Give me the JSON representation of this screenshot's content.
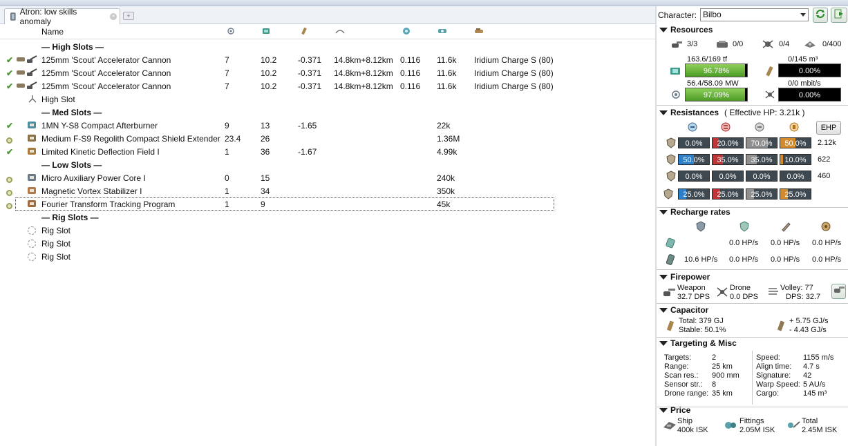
{
  "tab": {
    "title": "Atron: low skills anomaly"
  },
  "columns": {
    "name": "Name"
  },
  "rows": [
    {
      "kind": "section",
      "label": "— High Slots —"
    },
    {
      "kind": "module",
      "state": "active",
      "name": "125mm 'Scout' Accelerator Cannon",
      "cpu": "7",
      "pg": "10.2",
      "cap": "-0.371",
      "range": "14.8km+8.12km",
      "tracking": "0.116",
      "price": "11.6k",
      "charge": "Iridium Charge S (80)"
    },
    {
      "kind": "module",
      "state": "active",
      "name": "125mm 'Scout' Accelerator Cannon",
      "cpu": "7",
      "pg": "10.2",
      "cap": "-0.371",
      "range": "14.8km+8.12km",
      "tracking": "0.116",
      "price": "11.6k",
      "charge": "Iridium Charge S (80)"
    },
    {
      "kind": "module",
      "state": "active",
      "name": "125mm 'Scout' Accelerator Cannon",
      "cpu": "7",
      "pg": "10.2",
      "cap": "-0.371",
      "range": "14.8km+8.12km",
      "tracking": "0.116",
      "price": "11.6k",
      "charge": "Iridium Charge S (80)"
    },
    {
      "kind": "empty",
      "name": "High Slot"
    },
    {
      "kind": "section",
      "label": "— Med Slots —"
    },
    {
      "kind": "module",
      "state": "active",
      "name": "1MN Y-S8 Compact Afterburner",
      "cpu": "9",
      "pg": "13",
      "cap": "-1.65",
      "range": "",
      "tracking": "",
      "price": "22k",
      "charge": ""
    },
    {
      "kind": "module",
      "state": "online",
      "name": "Medium F-S9 Regolith Compact Shield Extender",
      "cpu": "23.4",
      "pg": "26",
      "cap": "",
      "range": "",
      "tracking": "",
      "price": "1.36M",
      "charge": ""
    },
    {
      "kind": "module",
      "state": "active",
      "name": "Limited Kinetic Deflection Field I",
      "cpu": "1",
      "pg": "36",
      "cap": "-1.67",
      "range": "",
      "tracking": "",
      "price": "4.99k",
      "charge": ""
    },
    {
      "kind": "section",
      "label": "— Low Slots —"
    },
    {
      "kind": "module",
      "state": "online",
      "name": "Micro Auxiliary Power Core I",
      "cpu": "0",
      "pg": "15",
      "cap": "",
      "range": "",
      "tracking": "",
      "price": "240k",
      "charge": ""
    },
    {
      "kind": "module",
      "state": "online",
      "name": "Magnetic Vortex Stabilizer I",
      "cpu": "1",
      "pg": "34",
      "cap": "",
      "range": "",
      "tracking": "",
      "price": "350k",
      "charge": ""
    },
    {
      "kind": "module",
      "state": "online",
      "name": "Fourier Transform Tracking Program",
      "cpu": "1",
      "pg": "9",
      "cap": "",
      "range": "",
      "tracking": "",
      "price": "45k",
      "charge": "",
      "selected": true
    },
    {
      "kind": "section",
      "label": "— Rig Slots —"
    },
    {
      "kind": "rig",
      "name": "Rig Slot"
    },
    {
      "kind": "rig",
      "name": "Rig Slot"
    },
    {
      "kind": "rig",
      "name": "Rig Slot"
    }
  ],
  "character": {
    "label": "Character:",
    "value": "Bilbo"
  },
  "resources": {
    "title": "Resources",
    "turrets": "3/3",
    "launchers": "0/0",
    "drone_bay": "0/4",
    "drone_bw_count": "0/400",
    "cpu_label": "163.6/169 tf",
    "cpu_pct": "96.78%",
    "cpu_frac": 0.9678,
    "cargo_label": "0/145 m³",
    "cargo_pct": "0.00%",
    "cargo_frac": 0,
    "pg_label": "56.4/58.09 MW",
    "pg_pct": "97.09%",
    "pg_frac": 0.9709,
    "bw_label": "0/0 mbit/s",
    "bw_pct": "0.00%",
    "bw_frac": 0
  },
  "resistances": {
    "title": "Resistances",
    "ehp_note": "( Effective HP: 3.21k )",
    "ehp_button": "EHP",
    "layers": [
      {
        "name": "shield",
        "values": [
          "0.0%",
          "20.0%",
          "70.0%",
          "50.0%"
        ],
        "fracs": [
          0,
          0.2,
          0.7,
          0.5
        ],
        "hp": "2.12k"
      },
      {
        "name": "armor",
        "values": [
          "50.0%",
          "35.0%",
          "35.0%",
          "10.0%"
        ],
        "fracs": [
          0.5,
          0.35,
          0.35,
          0.1
        ],
        "hp": "622"
      },
      {
        "name": "hull",
        "values": [
          "0.0%",
          "0.0%",
          "0.0%",
          "0.0%"
        ],
        "fracs": [
          0,
          0,
          0,
          0
        ],
        "hp": "460"
      },
      {
        "name": "damage-pattern",
        "values": [
          "25.0%",
          "25.0%",
          "25.0%",
          "25.0%"
        ],
        "fracs": [
          0.25,
          0.25,
          0.25,
          0.25
        ],
        "hp": ""
      }
    ],
    "colors": [
      "#2f7fc8",
      "#c13436",
      "#8f8f8f",
      "#d48a2a"
    ]
  },
  "recharge": {
    "title": "Recharge rates",
    "passive": [
      "",
      "0.0 HP/s",
      "0.0 HP/s",
      "0.0 HP/s"
    ],
    "reinforced": [
      "10.6 HP/s",
      "0.0 HP/s",
      "0.0 HP/s",
      "0.0 HP/s"
    ]
  },
  "firepower": {
    "title": "Firepower",
    "weapon_label": "Weapon",
    "weapon_value": "32.7 DPS",
    "drone_label": "Drone",
    "drone_value": "0.0 DPS",
    "volley_label": "Volley: 77",
    "dps_label": "DPS: 32.7"
  },
  "capacitor": {
    "title": "Capacitor",
    "total": "Total:  379 GJ",
    "stable": "Stable:  50.1%",
    "plus": "+ 5.75 GJ/s",
    "minus": "- 4.43 GJ/s"
  },
  "targeting": {
    "title": "Targeting & Misc",
    "left": [
      {
        "k": "Targets:",
        "v": "2"
      },
      {
        "k": "Range:",
        "v": "25 km"
      },
      {
        "k": "Scan res.:",
        "v": "900 mm"
      },
      {
        "k": "Sensor str.:",
        "v": "8"
      },
      {
        "k": "Drone range:",
        "v": "35 km"
      }
    ],
    "right": [
      {
        "k": "Speed:",
        "v": "1155 m/s"
      },
      {
        "k": "Align time:",
        "v": "4.7 s"
      },
      {
        "k": "Signature:",
        "v": "42"
      },
      {
        "k": "Warp Speed:",
        "v": "5 AU/s"
      },
      {
        "k": "Cargo:",
        "v": "145 m³"
      }
    ]
  },
  "price": {
    "title": "Price",
    "ship_label": "Ship",
    "ship_value": "400k ISK",
    "fittings_label": "Fittings",
    "fittings_value": "2.05M ISK",
    "total_label": "Total",
    "total_value": "2.45M ISK"
  }
}
